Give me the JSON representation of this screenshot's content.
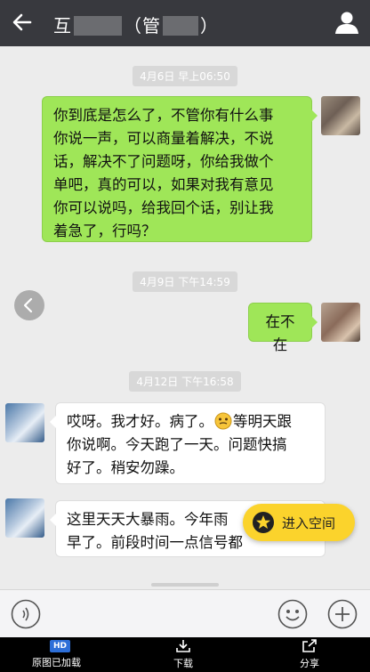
{
  "header": {
    "title_prefix": "互",
    "title_mid": "（管",
    "title_suffix": "）"
  },
  "messages": [
    {
      "timestamp": "4月6日 早上06:50"
    },
    {
      "from": "me",
      "lines": [
        "你到底是怎么了，不管你有什么事",
        "你说一声，可以商量着解决，不说",
        "话，解决不了问题呀，你给我做个",
        "单吧，真的可以，如果对我有意见",
        "你可以说吗，给我回个话，别让我",
        "着急了，行吗？"
      ]
    },
    {
      "timestamp": "4月9日 下午14:59"
    },
    {
      "from": "me",
      "lines": [
        "在不在"
      ]
    },
    {
      "timestamp": "4月12日 下午16:58"
    },
    {
      "from": "other",
      "lines": [
        "哎呀。我才好。病了。",
        "等明天跟",
        "你说啊。今天跑了一天。问题快搞",
        "好了。稍安勿躁。"
      ]
    },
    {
      "from": "other",
      "lines": [
        "这里天天大暴雨。今年雨",
        "早了。前段时间一点信号都"
      ]
    }
  ],
  "floating": {
    "enter_space": "进入空间"
  },
  "footer": {
    "hd_badge": "HD",
    "original_loaded": "原图已加载",
    "download": "下载",
    "share": "分享"
  },
  "colors": {
    "titlebar": "#38393e",
    "my_bubble": "#9fe658",
    "accent_yellow": "#fbd32c"
  },
  "icons": [
    "back-arrow-icon",
    "person-icon",
    "voice-icon",
    "emoji-icon",
    "plus-icon",
    "download-icon",
    "share-icon",
    "side-left-arrow-icon"
  ]
}
